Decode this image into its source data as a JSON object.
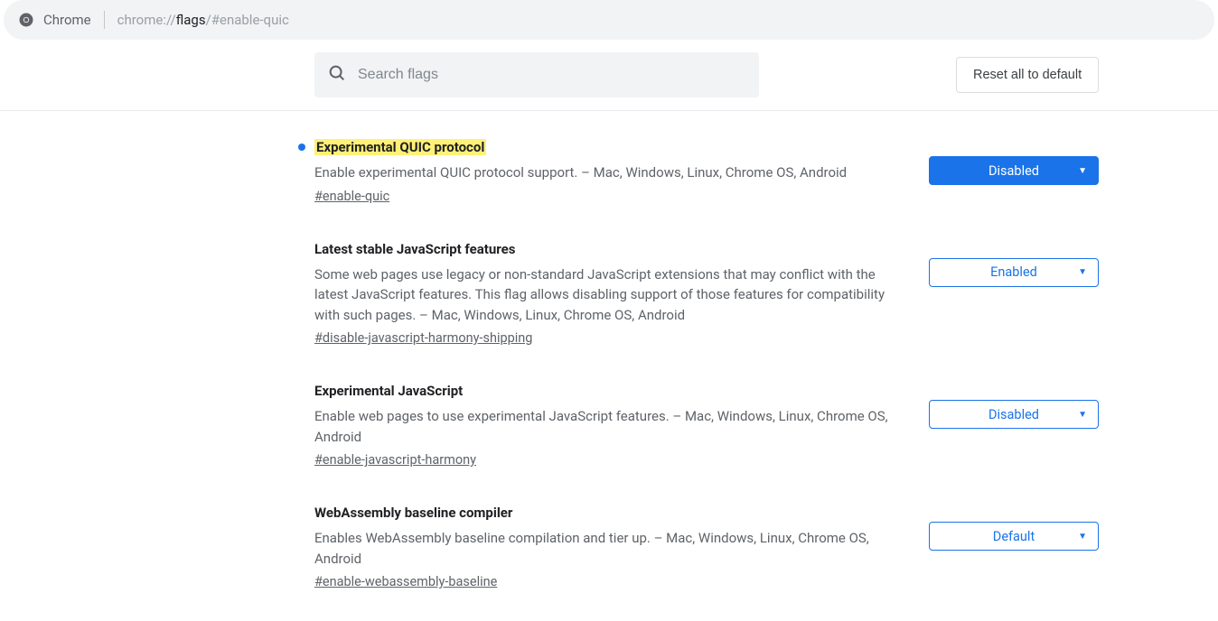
{
  "omnibox": {
    "app_label": "Chrome",
    "url_prefix": "chrome://",
    "url_strong": "flags",
    "url_suffix": "/#enable-quic"
  },
  "header": {
    "search_placeholder": "Search flags",
    "reset_label": "Reset all to default"
  },
  "flags": [
    {
      "title": "Experimental QUIC protocol",
      "highlight": true,
      "modified": true,
      "desc": "Enable experimental QUIC protocol support. – Mac, Windows, Linux, Chrome OS, Android",
      "anchor": "#enable-quic",
      "select_value": "Disabled",
      "select_filled": true
    },
    {
      "title": "Latest stable JavaScript features",
      "highlight": false,
      "modified": false,
      "desc": "Some web pages use legacy or non-standard JavaScript extensions that may conflict with the latest JavaScript features. This flag allows disabling support of those features for compatibility with such pages. – Mac, Windows, Linux, Chrome OS, Android",
      "anchor": "#disable-javascript-harmony-shipping",
      "select_value": "Enabled",
      "select_filled": false
    },
    {
      "title": "Experimental JavaScript",
      "highlight": false,
      "modified": false,
      "desc": "Enable web pages to use experimental JavaScript features. – Mac, Windows, Linux, Chrome OS, Android",
      "anchor": "#enable-javascript-harmony",
      "select_value": "Disabled",
      "select_filled": false
    },
    {
      "title": "WebAssembly baseline compiler",
      "highlight": false,
      "modified": false,
      "desc": "Enables WebAssembly baseline compilation and tier up. – Mac, Windows, Linux, Chrome OS, Android",
      "anchor": "#enable-webassembly-baseline",
      "select_value": "Default",
      "select_filled": false
    }
  ]
}
